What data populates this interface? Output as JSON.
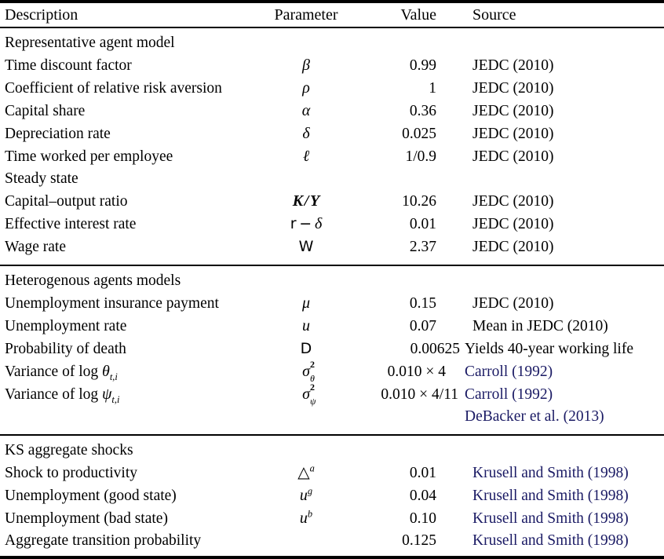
{
  "table": {
    "columns": [
      "Description",
      "Parameter",
      "Value",
      "Source"
    ],
    "link_color": "#1a1a64",
    "sections": [
      {
        "id": "representative-agent-model",
        "heading": "Representative agent model",
        "rows": [
          {
            "description": "Time discount factor",
            "parameter": "β",
            "value": "0.99",
            "source": "JEDC (2010)",
            "source_is_link": false
          },
          {
            "description": "Coefficient of relative risk aversion",
            "parameter": "ρ",
            "value": "1",
            "source": "JEDC (2010)",
            "source_is_link": false
          },
          {
            "description": "Capital share",
            "parameter": "α",
            "value": "0.36",
            "source": "JEDC (2010)",
            "source_is_link": false
          },
          {
            "description": "Depreciation rate",
            "parameter": "δ",
            "value": "0.025",
            "source": "JEDC (2010)",
            "source_is_link": false
          },
          {
            "description": "Time worked per employee",
            "parameter": "ℓ",
            "value": "1/0.9",
            "source": "JEDC (2010)",
            "source_is_link": false
          }
        ],
        "subheading": "Steady state",
        "subrows": [
          {
            "description": "Capital–output ratio",
            "parameter": "K/Y",
            "value": "10.26",
            "source": "JEDC (2010)",
            "source_is_link": false
          },
          {
            "description": "Effective interest rate",
            "parameter": "r − δ",
            "value": "0.01",
            "source": "JEDC (2010)",
            "source_is_link": false
          },
          {
            "description": "Wage rate",
            "parameter": "W",
            "value": "2.37",
            "source": "JEDC (2010)",
            "source_is_link": false
          }
        ]
      },
      {
        "id": "heterogenous-agents-models",
        "heading": "Heterogenous agents models",
        "rows": [
          {
            "description": "Unemployment insurance payment",
            "parameter": "μ",
            "value": "0.15",
            "source": "JEDC (2010)",
            "source_is_link": false
          },
          {
            "description": "Unemployment rate",
            "parameter": "u",
            "value": "0.07",
            "source": "Mean in JEDC (2010)",
            "source_is_link": false
          },
          {
            "description": "Probability of death",
            "parameter": "D",
            "value": "0.00625",
            "source": "Yields 40-year working life",
            "source_is_link": false
          },
          {
            "description": "Variance of log θt,i",
            "parameter": "σ²θ",
            "value": "0.010 × 4",
            "source": "Carroll (1992)",
            "source_is_link": true
          },
          {
            "description": "Variance of log ψt,i",
            "parameter": "σ²ψ",
            "value": "0.010 × 4/11",
            "source": "Carroll (1992)",
            "source_is_link": true
          },
          {
            "description": "",
            "parameter": "",
            "value": "",
            "source": "DeBacker et al. (2013)",
            "source_is_link": true
          }
        ]
      },
      {
        "id": "ks-aggregate-shocks",
        "heading": "KS aggregate shocks",
        "rows": [
          {
            "description": "Shock to productivity",
            "parameter": "△ᵃ",
            "value": "0.01",
            "source": "Krusell and Smith (1998)",
            "source_is_link": true
          },
          {
            "description": "Unemployment (good state)",
            "parameter": "uᵍ",
            "value": "0.04",
            "source": "Krusell and Smith (1998)",
            "source_is_link": true
          },
          {
            "description": "Unemployment (bad state)",
            "parameter": "uᵇ",
            "value": "0.10",
            "source": "Krusell and Smith (1998)",
            "source_is_link": true
          },
          {
            "description": "Aggregate transition probability",
            "parameter": "",
            "value": "0.125",
            "source": "Krusell and Smith (1998)",
            "source_is_link": true
          }
        ]
      }
    ]
  }
}
